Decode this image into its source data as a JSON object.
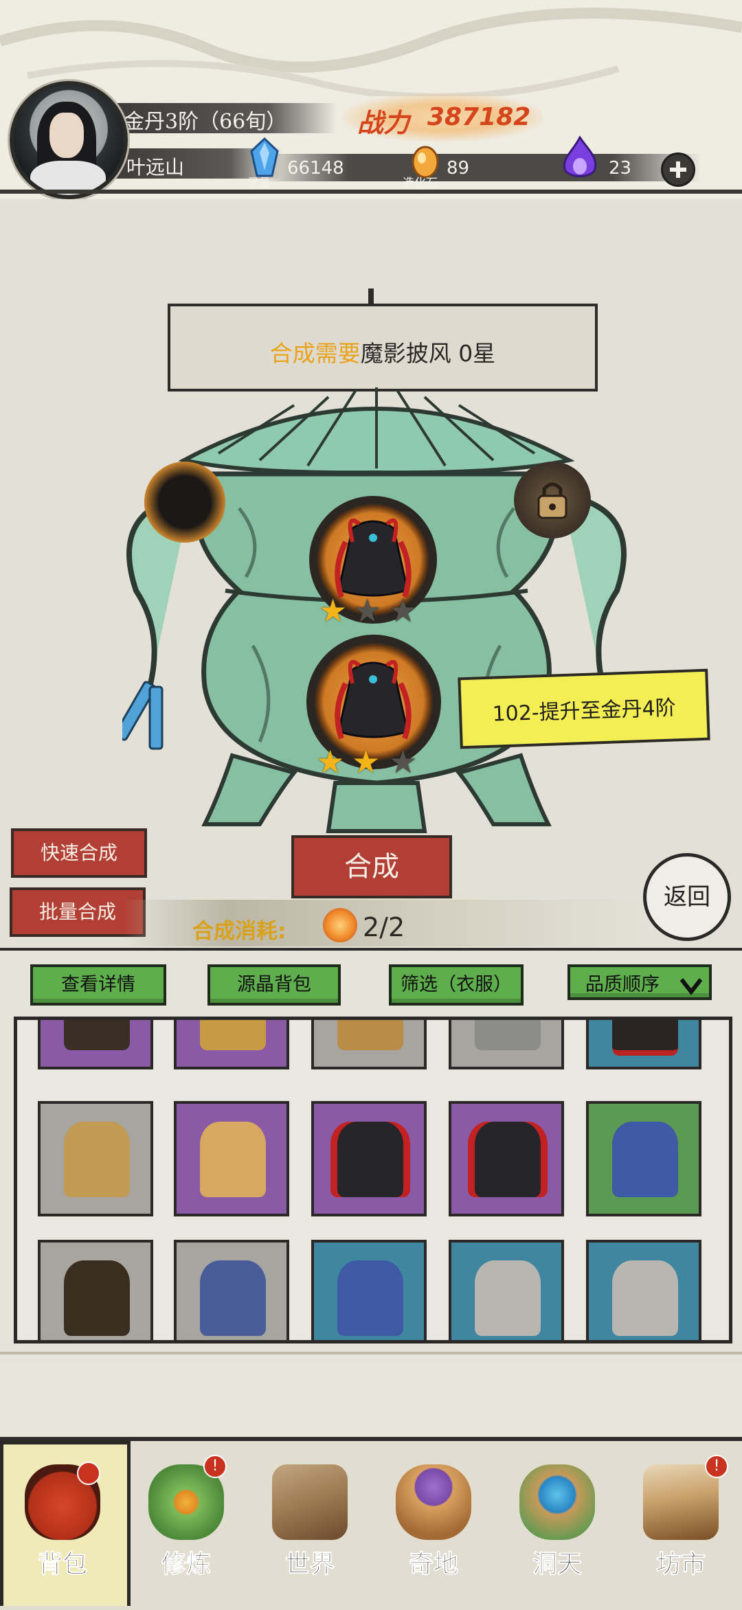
{
  "header": {
    "realm": "金丹3阶（66旬）",
    "player_name": "叶远山",
    "power_label": "战力",
    "power_value": "387182",
    "resources": [
      {
        "icon": "spirit-crystal-icon",
        "label": "灵晶",
        "value": "66148"
      },
      {
        "icon": "creation-stone-icon",
        "label": "造化石",
        "value": "89"
      },
      {
        "icon": "purple-flame-icon",
        "label": "",
        "value": "23"
      }
    ],
    "add_icon": "plus-icon"
  },
  "synthesis": {
    "requirement_prefix": "合成需要",
    "requirement_item": "魔影披风 0星",
    "upper_slot_stars": {
      "filled": 1,
      "total": 3
    },
    "lower_slot_stars": {
      "filled": 2,
      "total": 3
    },
    "upgrade_tag": "102-提升至金丹4阶",
    "quick_label": "快速合成",
    "batch_label": "批量合成",
    "merge_label": "合成",
    "return_label": "返回",
    "cost_label": "合成消耗:",
    "cost_value": "2/2"
  },
  "inventory": {
    "toolbar": [
      "查看详情",
      "源晶背包",
      "筛选（衣服）",
      "品质顺序"
    ],
    "rows": [
      [
        "purple",
        "purple",
        "grey",
        "grey",
        "teal"
      ],
      [
        "grey",
        "purple",
        "purple",
        "purple",
        "green"
      ],
      [
        "grey",
        "grey",
        "teal",
        "teal",
        "teal"
      ]
    ]
  },
  "nav": [
    {
      "label": "背包",
      "active": true,
      "badge": ""
    },
    {
      "label": "修炼",
      "active": false,
      "badge": "!"
    },
    {
      "label": "世界",
      "active": false,
      "badge": ""
    },
    {
      "label": "奇地",
      "active": false,
      "badge": ""
    },
    {
      "label": "洞天",
      "active": false,
      "badge": ""
    },
    {
      "label": "坊市",
      "active": false,
      "badge": "!"
    }
  ],
  "colors": {
    "accent_gold": "#e8a31a",
    "power_red": "#d4451b",
    "button_red": "#b23f35",
    "tool_green": "#5fae4d",
    "quality_purple": "#8a5aa6",
    "quality_teal": "#3f86a0",
    "quality_green": "#5b9a52",
    "quality_grey": "#a6a5a0"
  }
}
